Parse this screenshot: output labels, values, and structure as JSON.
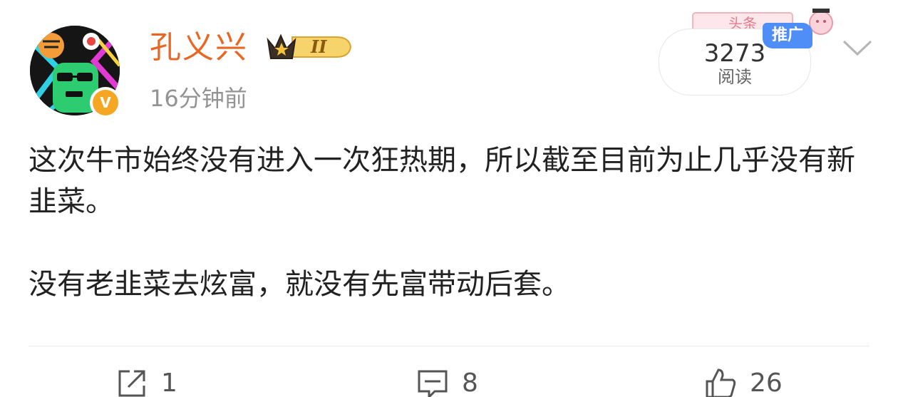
{
  "user": {
    "name": "孔义兴",
    "vip_level": "II",
    "time": "16分钟前"
  },
  "read_counter": {
    "count": "3273",
    "label": "阅读",
    "promo_badge": "推广",
    "top_mark": "头条"
  },
  "post": {
    "paragraphs": [
      "这次牛市始终没有进入一次狂热期，所以截至目前为止几乎没有新韭菜。",
      "没有老韭菜去炫富，就没有先富带动后套。"
    ]
  },
  "actions": {
    "repost_count": "1",
    "comment_count": "8",
    "like_count": "26"
  },
  "colors": {
    "username": "#e86722",
    "time": "#939393",
    "badge_blue": "#4f8ef7",
    "verified": "#f5a623",
    "text": "#222222"
  },
  "icons": [
    "avatar",
    "verified-icon",
    "crown-icon",
    "chevron-down-icon",
    "repost-icon",
    "comment-icon",
    "like-icon"
  ]
}
